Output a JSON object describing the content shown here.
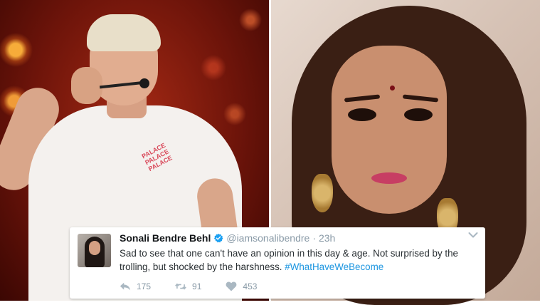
{
  "tweet": {
    "name": "Sonali Bendre Behl",
    "handle": "@iamsonalibendre",
    "separator": "·",
    "time": "23h",
    "text": "Sad to see that one can't have an opinion in this day & age. Not surprised by the trolling, but shocked by the harshness.",
    "hashtag": "#WhatHaveWeBecome",
    "replies": "175",
    "retweets": "91",
    "likes": "453",
    "hashtag_color": "#1b95e0",
    "verified_color": "#1da1f2"
  },
  "left_photo": {
    "shirt_print": [
      "PALACE",
      "PALACE",
      "PALACE"
    ]
  },
  "icons": [
    "verified-badge-icon",
    "chevron-down-icon",
    "reply-icon",
    "retweet-icon",
    "heart-icon"
  ]
}
